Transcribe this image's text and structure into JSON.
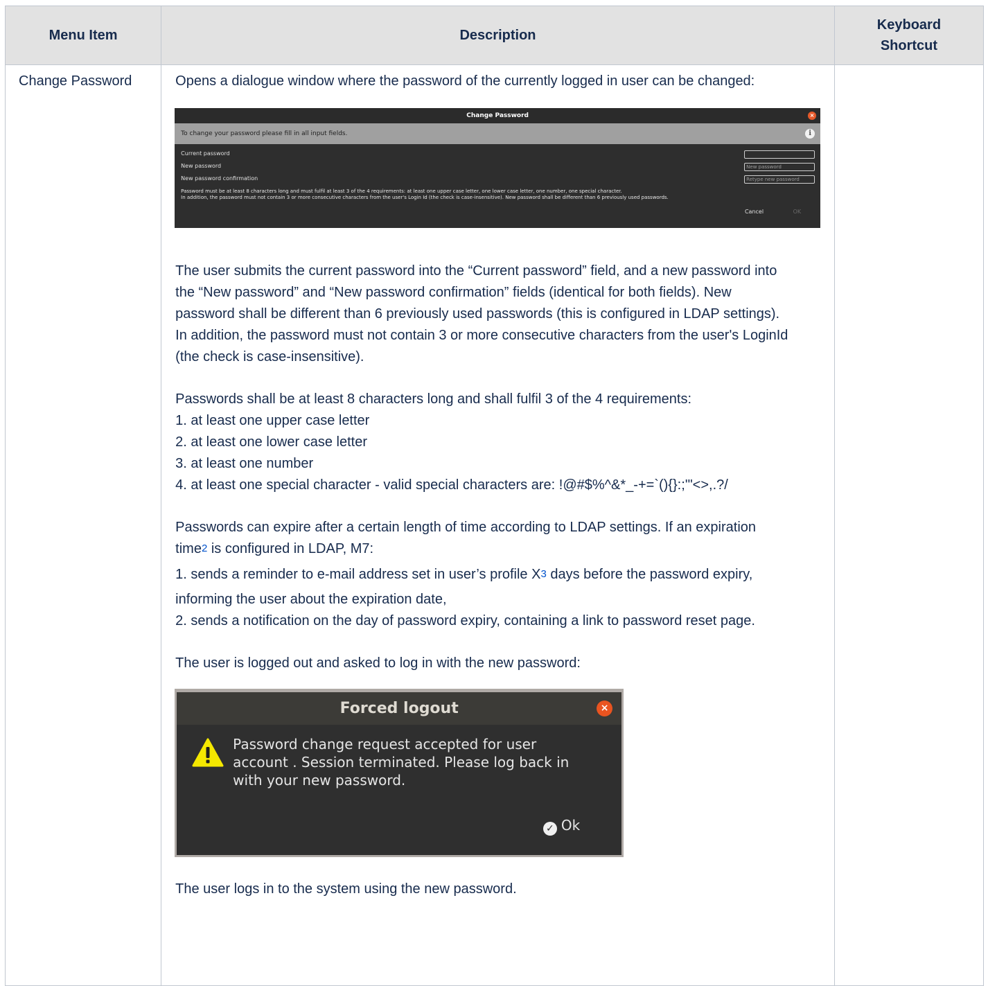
{
  "table": {
    "headers": {
      "menu_item": "Menu Item",
      "description": "Description",
      "keyboard_shortcut_line1": "Keyboard",
      "keyboard_shortcut_line2": "Shortcut"
    },
    "row": {
      "menu_item": "Change Password",
      "intro": "Opens a dialogue window where the password of the currently logged in user can be changed:",
      "submit_paragraph": [
        "The user submits the current password into the “Current password” field, and a new password into",
        "the “New password” and “New password confirmation” fields (identical for both fields). New",
        "password shall be different than 6 previously used passwords (this is configured in LDAP settings).",
        "In addition, the password must not contain 3 or more consecutive characters from the user's LoginId",
        "(the check is case-insensitive)."
      ],
      "requirements_intro": "Passwords shall be at least 8 characters long and shall fulfil 3 of the 4 requirements:",
      "requirements": [
        "1. at least one upper case letter",
        "2. at least one lower case letter",
        "3. at least one number",
        "4. at least one special character - valid special characters are: !@#$%^&*_-+=`(){}:;'\"<>,.?/"
      ],
      "expiry_line1": "Passwords can expire after a certain length of time according to LDAP settings. If an expiration",
      "expiry_line2_a": "time",
      "expiry_footnote_1": "2",
      "expiry_line2_b": " is configured in LDAP, M7:",
      "expiry_item1_a": "1. sends a reminder to e-mail address set in user’s profile X",
      "expiry_footnote_2": "3",
      "expiry_item1_b": " days before the password expiry,",
      "expiry_item1_c": "informing the user about the expiration date,",
      "expiry_item2": "2. sends a notification on the day of password expiry, containing a link to password reset page.",
      "logout_intro": "The user is logged out and asked to log in with the new password:",
      "final": "The user logs in to the system using the new password."
    }
  },
  "change_password_dialog": {
    "title": "Change Password",
    "close_glyph": "×",
    "info_text": "To change your password please fill in all input fields.",
    "info_glyph": "i",
    "current_password_label": "Current password",
    "current_password_value": "",
    "new_password_label": "New password",
    "new_password_placeholder": "New password",
    "confirm_label": "New password confirmation",
    "confirm_placeholder": "Retype new password",
    "note_line1": "Password must be at least 8 characters long and must fulfil at least 3 of the 4 requirements: at least one upper case letter, one lower case letter, one number, one special character.",
    "note_line2": "In addition, the password must not contain 3 or more consecutive characters from the user's Login Id (the check is case-insensitive). New password shall be different than 6 previously used passwords.",
    "cancel": "Cancel",
    "ok": "OK"
  },
  "forced_logout_dialog": {
    "title": "Forced logout",
    "close_glyph": "×",
    "message_line1": "Password change request accepted for user",
    "message_line2": "account . Session terminated. Please log back in",
    "message_line3": "with your new password.",
    "check_glyph": "✓",
    "ok": "Ok"
  }
}
